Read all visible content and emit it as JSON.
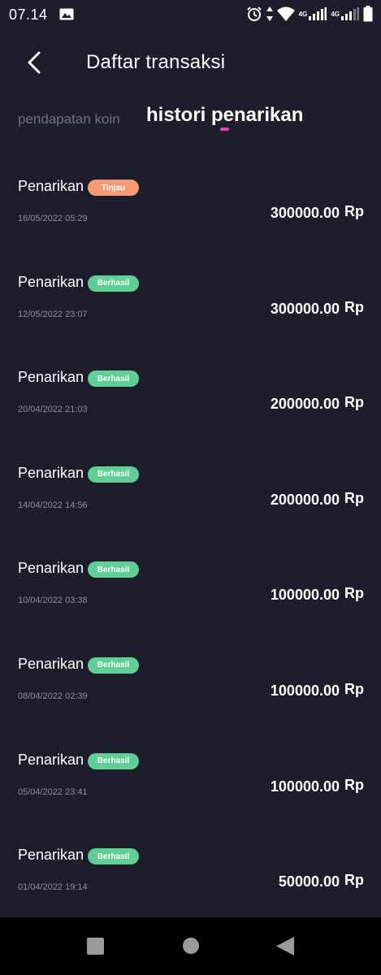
{
  "status_bar": {
    "time": "07.14",
    "network_label_1": "4G",
    "network_label_2": "4G",
    "icons": [
      "gallery-icon",
      "alarm-icon",
      "data-arrows-icon",
      "wifi-icon",
      "signal-icon",
      "signal-icon",
      "battery-icon"
    ]
  },
  "header": {
    "title": "Daftar transaksi",
    "back_icon": "back-arrow-icon"
  },
  "tabs": [
    {
      "label": "pendapatan koin",
      "active": false
    },
    {
      "label": "histori penarikan",
      "active": true
    }
  ],
  "colors": {
    "background": "#1d1d2b",
    "tab_indicator": "#e63fb5",
    "badge_review": "#f49b74",
    "badge_success": "#5fcf95"
  },
  "transactions": [
    {
      "title": "Penarikan",
      "status": "Tinjau",
      "date": "16/05/2022 05:29",
      "amount": "300000.00",
      "currency": "Rp"
    },
    {
      "title": "Penarikan",
      "status": "Berhasil",
      "date": "12/05/2022 23:07",
      "amount": "300000.00",
      "currency": "Rp"
    },
    {
      "title": "Penarikan",
      "status": "Berhasil",
      "date": "20/04/2022 21:03",
      "amount": "200000.00",
      "currency": "Rp"
    },
    {
      "title": "Penarikan",
      "status": "Berhasil",
      "date": "14/04/2022 14:56",
      "amount": "200000.00",
      "currency": "Rp"
    },
    {
      "title": "Penarikan",
      "status": "Berhasil",
      "date": "10/04/2022 03:38",
      "amount": "100000.00",
      "currency": "Rp"
    },
    {
      "title": "Penarikan",
      "status": "Berhasil",
      "date": "08/04/2022 02:39",
      "amount": "100000.00",
      "currency": "Rp"
    },
    {
      "title": "Penarikan",
      "status": "Berhasil",
      "date": "05/04/2022 23:41",
      "amount": "100000.00",
      "currency": "Rp"
    },
    {
      "title": "Penarikan",
      "status": "Berhasil",
      "date": "01/04/2022 19:14",
      "amount": "50000.00",
      "currency": "Rp"
    }
  ],
  "nav_bar": {
    "buttons": [
      "recents-button",
      "home-button",
      "back-button"
    ]
  }
}
